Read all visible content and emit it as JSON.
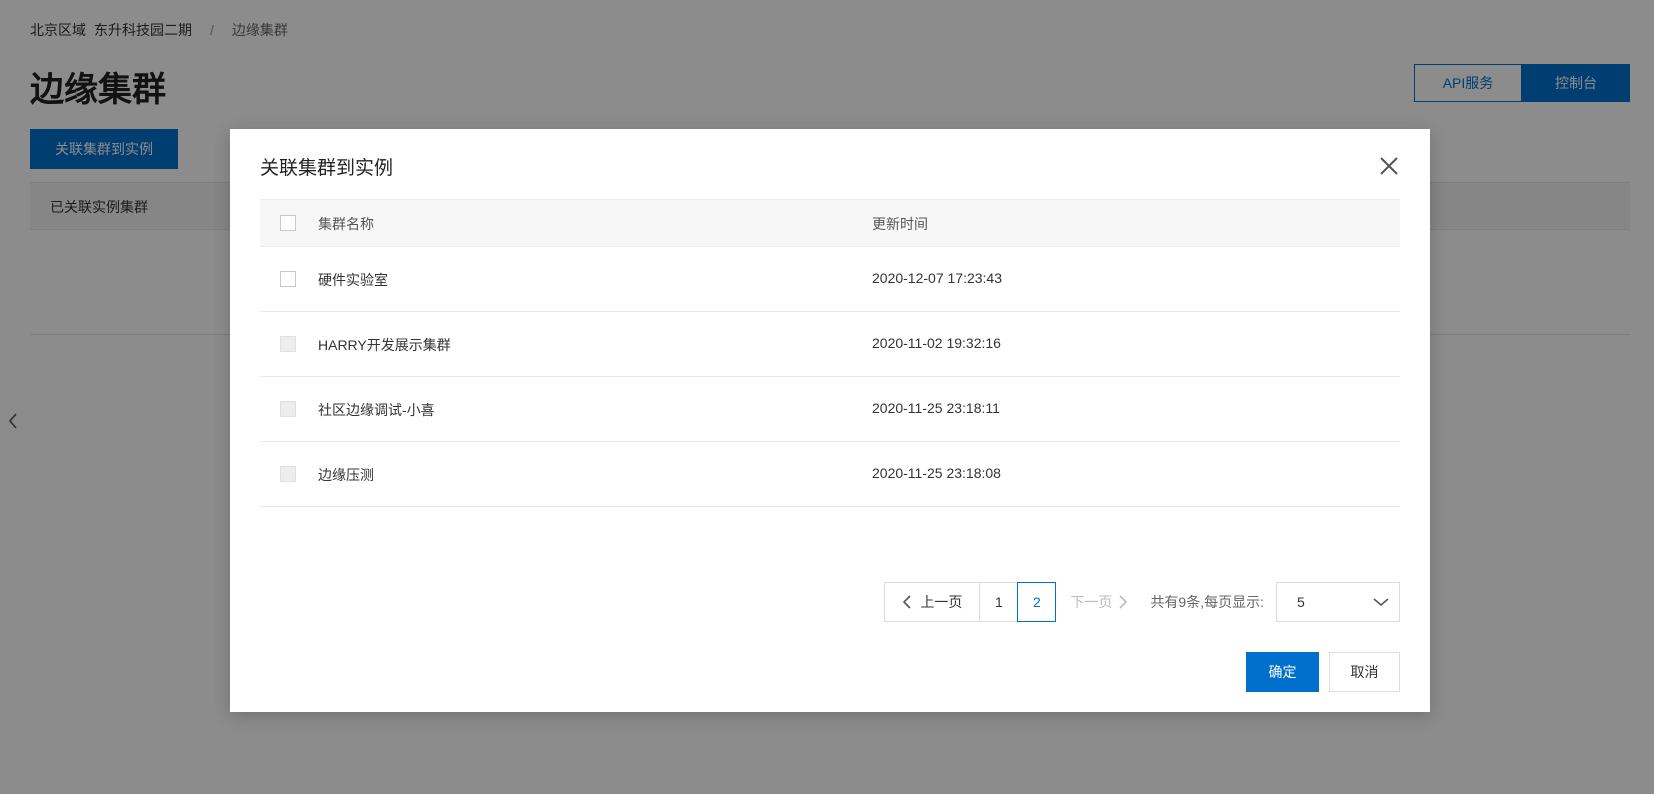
{
  "page": {
    "breadcrumb": {
      "region": "北京区域",
      "project": "东升科技园二期",
      "separator": "/",
      "current": "边缘集群"
    },
    "title": "边缘集群",
    "api_button": "API服务",
    "console_button": "控制台",
    "primary_action": "关联集群到实例",
    "tab_label": "已关联实例集群"
  },
  "modal": {
    "title": "关联集群到实例",
    "columns": {
      "name": "集群名称",
      "time": "更新时间"
    },
    "rows": [
      {
        "name": "硬件实验室",
        "time": "2020-12-07 17:23:43",
        "disabled": false
      },
      {
        "name": "HARRY开发展示集群",
        "time": "2020-11-02 19:32:16",
        "disabled": true
      },
      {
        "name": "社区边缘调试-小喜",
        "time": "2020-11-25 23:18:11",
        "disabled": true
      },
      {
        "name": "边缘压测",
        "time": "2020-11-25 23:18:08",
        "disabled": true
      }
    ],
    "pagination": {
      "prev_label": "上一页",
      "pages": [
        "1",
        "2"
      ],
      "current_page": "2",
      "next_label": "下一页",
      "total_text": "共有9条,每页显示:",
      "page_size": "5"
    },
    "confirm_label": "确定",
    "cancel_label": "取消"
  },
  "colors": {
    "primary": "#0070cc",
    "overlay": "rgba(0,0,0,0.45)"
  }
}
